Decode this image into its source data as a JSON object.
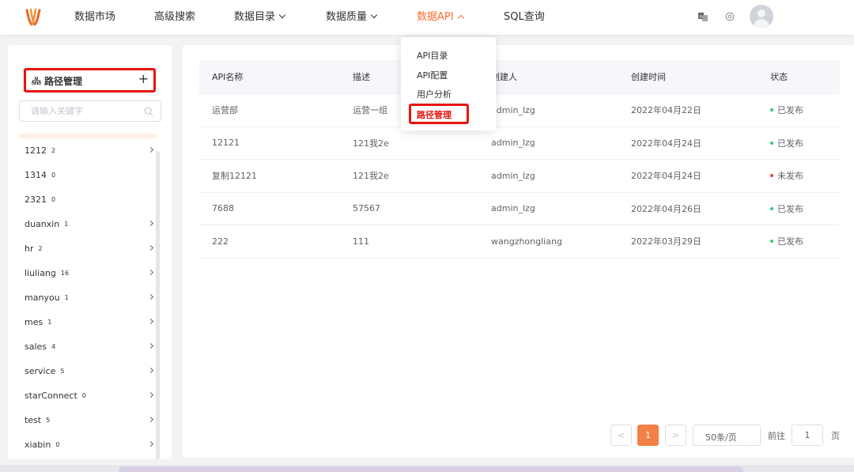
{
  "nav": {
    "items": [
      {
        "label": "数据市场",
        "has_chevron": false,
        "active": false
      },
      {
        "label": "高级搜索",
        "has_chevron": false,
        "active": false
      },
      {
        "label": "数据目录",
        "has_chevron": true,
        "active": false
      },
      {
        "label": "数据质量",
        "has_chevron": true,
        "active": false
      },
      {
        "label": "数据API",
        "has_chevron": true,
        "active": true
      },
      {
        "label": "SQL查询",
        "has_chevron": false,
        "active": false
      }
    ],
    "icons": [
      "translate-icon",
      "settings-icon",
      "avatar"
    ],
    "accent_color": "#ff6b2c"
  },
  "dropdown": {
    "items": [
      "API目录",
      "API配置",
      "用户分析",
      "路径管理"
    ],
    "highlighted": "路径管理"
  },
  "sidebar": {
    "title": "路径管理",
    "add_label": "+",
    "search_placeholder": "请输入关键字",
    "items": [
      {
        "label": "1212",
        "count": "2",
        "expandable": true
      },
      {
        "label": "1314",
        "count": "0",
        "expandable": false
      },
      {
        "label": "2321",
        "count": "0",
        "expandable": false
      },
      {
        "label": "duanxin",
        "count": "1",
        "expandable": true
      },
      {
        "label": "hr",
        "count": "2",
        "expandable": true
      },
      {
        "label": "liuliang",
        "count": "16",
        "expandable": true
      },
      {
        "label": "manyou",
        "count": "1",
        "expandable": true
      },
      {
        "label": "mes",
        "count": "1",
        "expandable": true
      },
      {
        "label": "sales",
        "count": "4",
        "expandable": true
      },
      {
        "label": "service",
        "count": "5",
        "expandable": true
      },
      {
        "label": "starConnect",
        "count": "0",
        "expandable": true
      },
      {
        "label": "test",
        "count": "5",
        "expandable": true
      },
      {
        "label": "xiabin",
        "count": "0",
        "expandable": true
      }
    ]
  },
  "table": {
    "columns": [
      "API名称",
      "描述",
      "创建人",
      "创建时间",
      "状态"
    ],
    "rows": [
      {
        "name": "运营部",
        "desc": "运营一组",
        "creator": "admin_lzg",
        "created": "2022年04月22日",
        "status": "已发布",
        "status_color": "#2ecc71"
      },
      {
        "name": "12121",
        "desc": "121我2e",
        "creator": "admin_lzg",
        "created": "2022年04月24日",
        "status": "已发布",
        "status_color": "#2ecc71"
      },
      {
        "name": "复制12121",
        "desc": "121我2e",
        "creator": "admin_lzg",
        "created": "2022年04月24日",
        "status": "未发布",
        "status_color": "#f04134"
      },
      {
        "name": "7688",
        "desc": "57567",
        "creator": "admin_lzg",
        "created": "2022年04月26日",
        "status": "已发布",
        "status_color": "#2ecc71"
      },
      {
        "name": "222",
        "desc": "111",
        "creator": "wangzhongliang",
        "created": "2022年03月29日",
        "status": "已发布",
        "status_color": "#2ecc71"
      }
    ]
  },
  "pagination": {
    "prev": "<",
    "current": "1",
    "next": ">",
    "page_size": "50条/页",
    "goto_label": "前往",
    "goto_value": "1",
    "page_unit": "页"
  }
}
